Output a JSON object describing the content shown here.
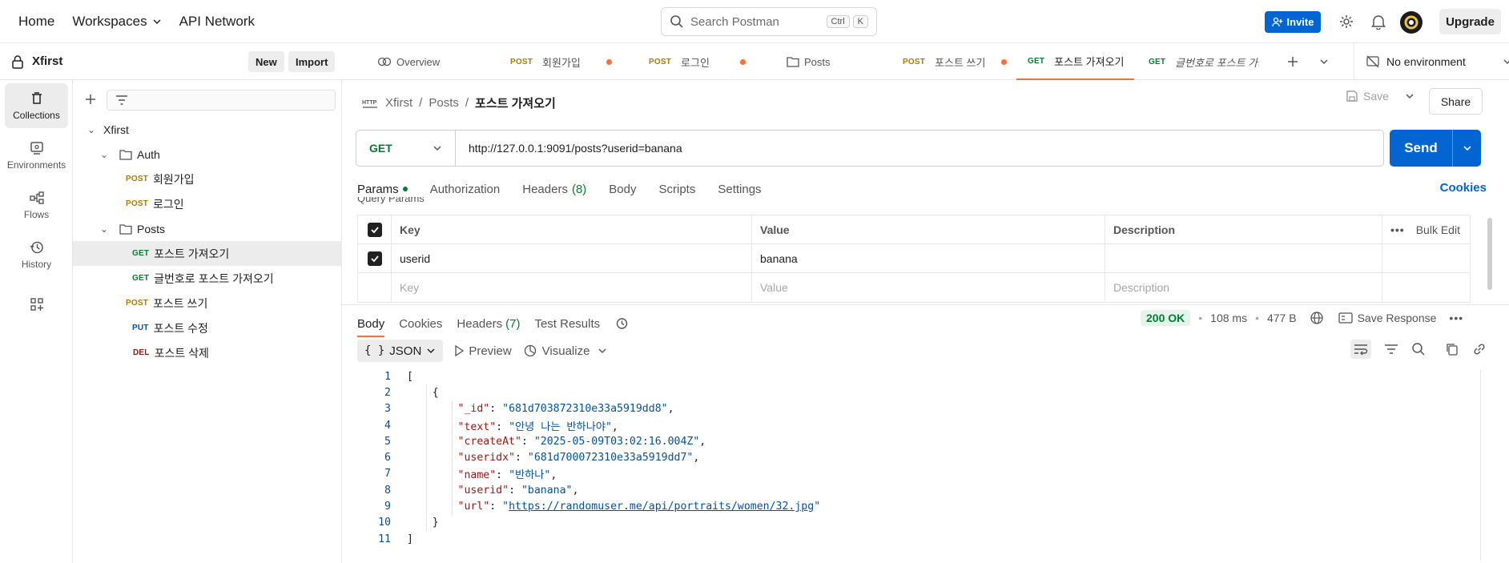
{
  "topnav": {
    "home": "Home",
    "workspaces": "Workspaces",
    "api_network": "API Network",
    "search_placeholder": "Search Postman",
    "shortcut_ctrl": "Ctrl",
    "shortcut_k": "K",
    "invite": "Invite",
    "upgrade": "Upgrade"
  },
  "rail": {
    "collections": "Collections",
    "environments": "Environments",
    "flows": "Flows",
    "history": "History"
  },
  "workspace": {
    "name": "Xfirst",
    "new_label": "New",
    "import_label": "Import"
  },
  "tree": {
    "collection": "Xfirst",
    "folders": [
      {
        "name": "Auth",
        "items": [
          {
            "method": "POST",
            "name": "회원가입"
          },
          {
            "method": "POST",
            "name": "로그인"
          }
        ]
      },
      {
        "name": "Posts",
        "items": [
          {
            "method": "GET",
            "name": "포스트 가져오기"
          },
          {
            "method": "GET",
            "name": "글번호로 포스트 가져오기"
          },
          {
            "method": "POST",
            "name": "포스트 쓰기"
          },
          {
            "method": "PUT",
            "name": "포스트 수정"
          },
          {
            "method": "DEL",
            "name": "포스트 삭제"
          }
        ]
      }
    ]
  },
  "tabs": [
    {
      "label": "Overview"
    },
    {
      "method": "POST",
      "label": "회원가입"
    },
    {
      "method": "POST",
      "label": "로그인"
    },
    {
      "label": "Posts"
    },
    {
      "method": "POST",
      "label": "포스트 쓰기"
    },
    {
      "method": "GET",
      "label": "포스트 가져오기"
    },
    {
      "method": "GET",
      "label": "글번호로 포스트 가져오기"
    }
  ],
  "environment": "No environment",
  "request": {
    "breadcrumb": [
      "Xfirst",
      "Posts",
      "포스트 가져오기"
    ],
    "save_label": "Save",
    "share_label": "Share",
    "method": "GET",
    "url": "http://127.0.0.1:9091/posts?userid=banana",
    "send_label": "Send",
    "tabs": [
      "Params",
      "Authorization",
      "Headers",
      "Body",
      "Scripts",
      "Settings"
    ],
    "headers_count": "(8)",
    "cookies_label": "Cookies",
    "query_params_label": "Query Params"
  },
  "params": {
    "headers": {
      "key": "Key",
      "value": "Value",
      "description": "Description",
      "bulk_edit": "Bulk Edit"
    },
    "rows": [
      {
        "key": "userid",
        "value": "banana",
        "description": ""
      }
    ],
    "placeholders": {
      "key": "Key",
      "value": "Value",
      "description": "Description"
    }
  },
  "response": {
    "tabs": [
      "Body",
      "Cookies",
      "Headers",
      "Test Results"
    ],
    "headers_count": "(7)",
    "status": "200 OK",
    "time": "108 ms",
    "size": "477 B",
    "save_response": "Save Response",
    "format": "JSON",
    "preview": "Preview",
    "visualize": "Visualize"
  },
  "body_json": {
    "_id": "681d703872310e33a5919dd8",
    "text": "안녕 나는 반하나야",
    "createAt": "2025-05-09T03:02:16.004Z",
    "useridx": "681d700072310e33a5919dd7",
    "name": "반하나",
    "userid": "banana",
    "url": "https://randomuser.me/api/portraits/women/32.jpg"
  },
  "colors": {
    "accent": "#ff6c37",
    "primary": "#0265d2",
    "get": "#007f31",
    "post": "#ad7a03",
    "put": "#0053b8",
    "del": "#8e1a10"
  }
}
